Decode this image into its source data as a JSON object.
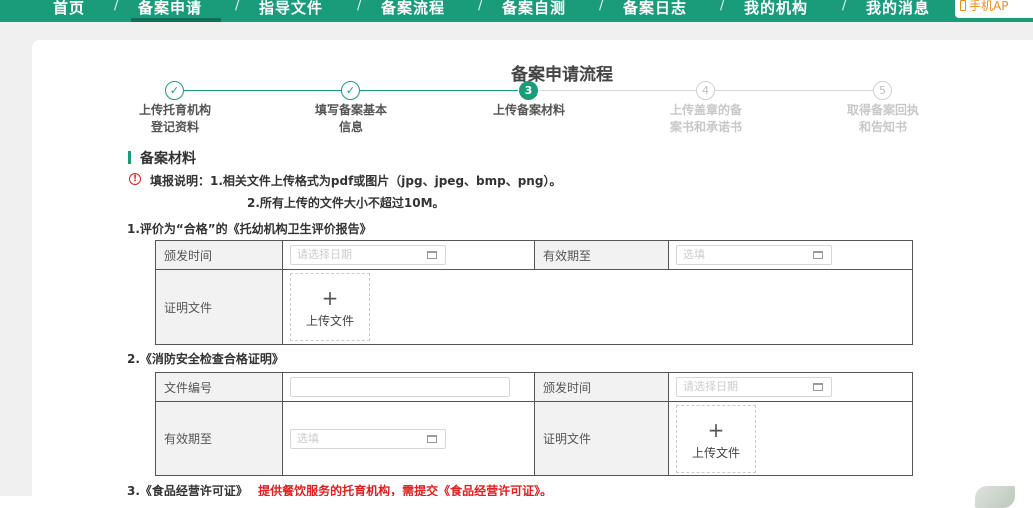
{
  "nav": {
    "items": [
      "首页",
      "备案申请",
      "指导文件",
      "备案流程",
      "备案自测",
      "备案日志",
      "我的机构",
      "我的消息"
    ],
    "separator": "/",
    "active_index": 1,
    "mobile_button": "手机AP",
    "accent_color": "#1a9b7a"
  },
  "page": {
    "title": "备案申请流程"
  },
  "steps": [
    {
      "marker": "✓",
      "label_line1": "上传托育机构",
      "label_line2": "登记资料",
      "status": "done"
    },
    {
      "marker": "✓",
      "label_line1": "填写备案基本",
      "label_line2": "信息",
      "status": "done"
    },
    {
      "marker": "3",
      "label_line1": "上传备案材料",
      "label_line2": "",
      "status": "active"
    },
    {
      "marker": "4",
      "label_line1": "上传盖章的备",
      "label_line2": "案书和承诺书",
      "status": "pending"
    },
    {
      "marker": "5",
      "label_line1": "取得备案回执",
      "label_line2": "和告知书",
      "status": "pending"
    }
  ],
  "section": {
    "title": "备案材料",
    "notice_icon": "warning-circle-icon",
    "notice_line1": "填报说明：1.相关文件上传格式为pdf或图片（jpg、jpeg、bmp、png）。",
    "notice_line2": "2.所有上传的文件大小不超过10M。"
  },
  "item1": {
    "title": "1.评价为“合格”的《托幼机构卫生评价报告》",
    "issue_date_label": "颁发时间",
    "issue_date_placeholder": "请选择日期",
    "valid_until_label": "有效期至",
    "valid_until_placeholder": "选填",
    "cert_label": "证明文件",
    "upload_plus": "+",
    "upload_label": "上传文件"
  },
  "item2": {
    "title": "2.《消防安全检查合格证明》",
    "doc_no_label": "文件编号",
    "doc_no_value": "",
    "issue_date_label": "颁发时间",
    "issue_date_placeholder": "请选择日期",
    "valid_until_label": "有效期至",
    "valid_until_placeholder": "选填",
    "cert_label": "证明文件",
    "upload_plus": "+",
    "upload_label": "上传文件"
  },
  "item3": {
    "title": "3.《食品经营许可证》",
    "warning": "提供餐饮服务的托育机构，需提交《食品经营许可证》。"
  }
}
